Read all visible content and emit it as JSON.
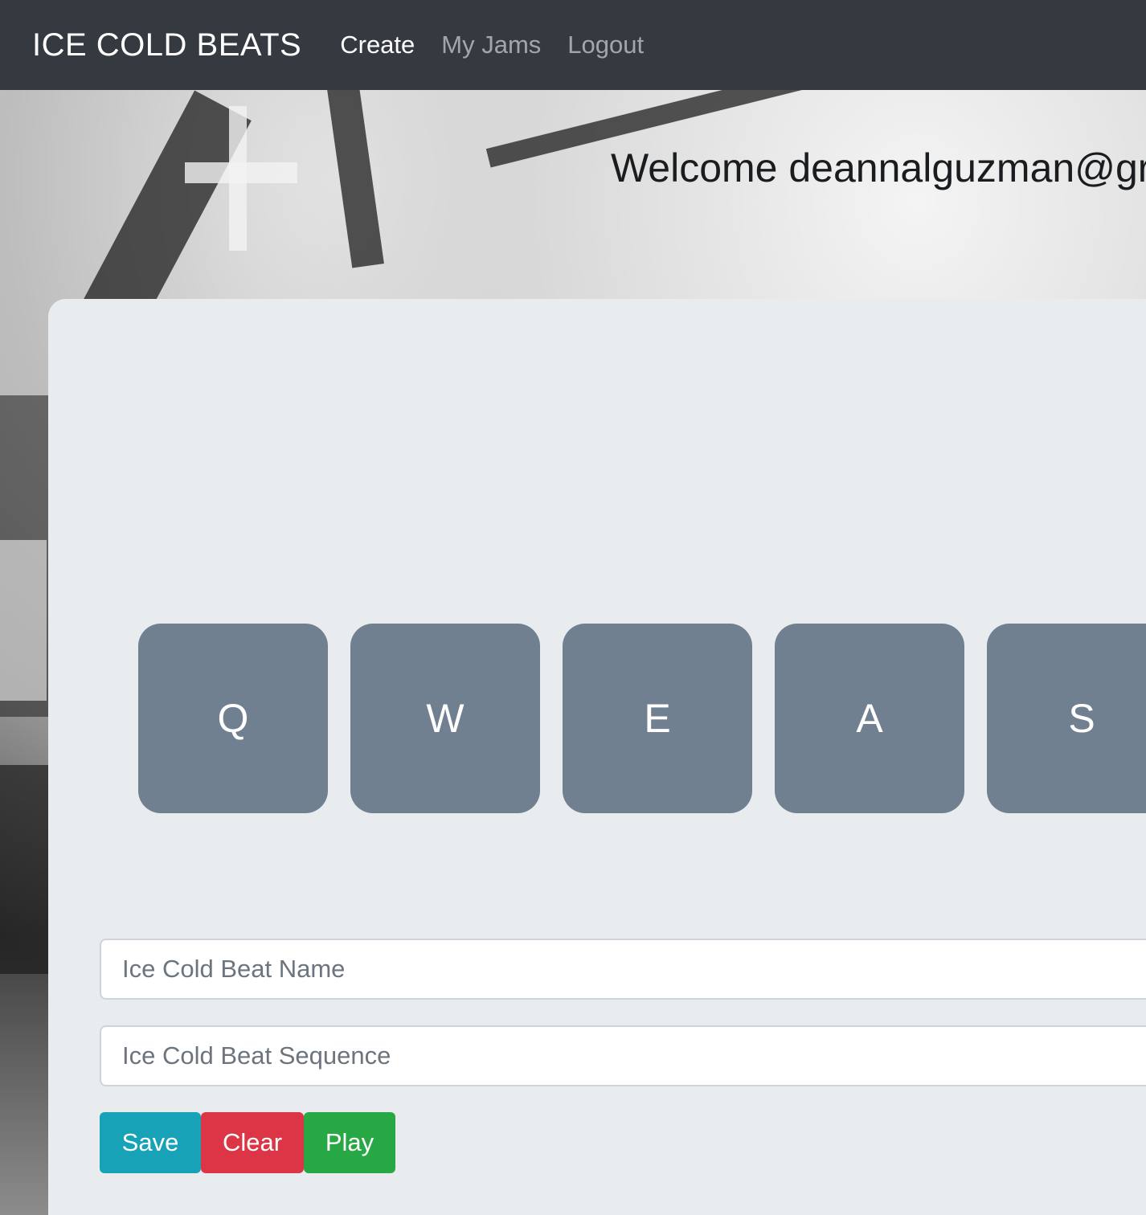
{
  "navbar": {
    "brand": "ICE COLD BEATS",
    "links": [
      {
        "label": "Create",
        "active": true
      },
      {
        "label": "My Jams",
        "active": false
      },
      {
        "label": "Logout",
        "active": false
      }
    ]
  },
  "welcome_text": "Welcome deannalguzman@gr",
  "pads": [
    {
      "key": "Q"
    },
    {
      "key": "W"
    },
    {
      "key": "E"
    },
    {
      "key": "A"
    },
    {
      "key": "S"
    }
  ],
  "form": {
    "name_placeholder": "Ice Cold Beat Name",
    "sequence_placeholder": "Ice Cold Beat Sequence"
  },
  "buttons": {
    "save": "Save",
    "clear": "Clear",
    "play": "Play"
  },
  "colors": {
    "navbar": "#343a40",
    "panel": "#e9ecef",
    "pad": "#708090",
    "save": "#17a2b8",
    "clear": "#dc3545",
    "play": "#28a745"
  }
}
